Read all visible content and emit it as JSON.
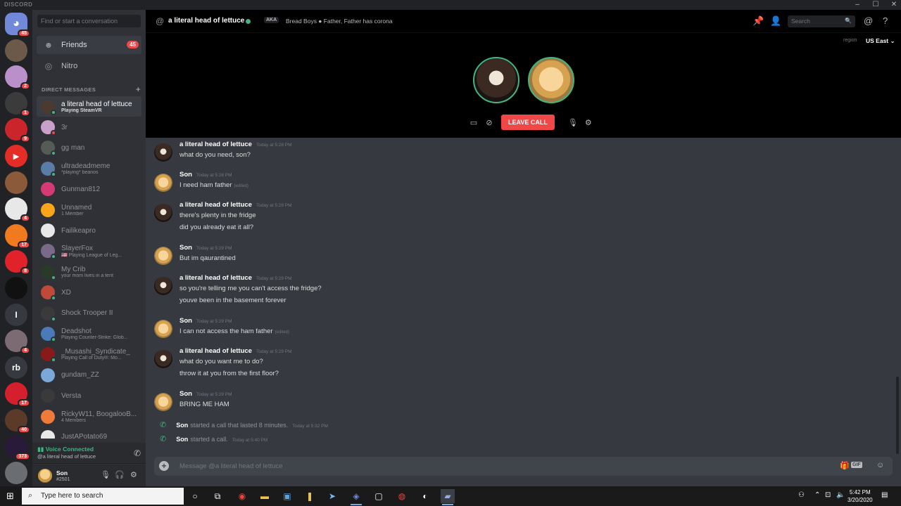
{
  "app": {
    "brand": "DISCORD"
  },
  "window_controls": [
    "–",
    "☐",
    "✕"
  ],
  "rail": {
    "items": [
      {
        "icon": "discord-home-icon",
        "badge": "45",
        "color": "#7289da",
        "label": ""
      },
      {
        "icon": "server-avatar-icon",
        "badge": "",
        "color": "#6b5a4a",
        "label": ""
      },
      {
        "icon": "server-avatar-icon",
        "badge": "2",
        "color": "#b990c9",
        "label": ""
      },
      {
        "icon": "server-avatar-icon",
        "badge": "1",
        "color": "#3b3b3b",
        "label": ""
      },
      {
        "icon": "server-avatar-icon",
        "badge": "9",
        "color": "#c9252b",
        "label": ""
      },
      {
        "icon": "youtube-server-icon",
        "badge": "",
        "color": "#e52d27",
        "label": ""
      },
      {
        "icon": "server-avatar-icon",
        "badge": "",
        "color": "#8a5a3a",
        "label": ""
      },
      {
        "icon": "server-avatar-icon",
        "badge": "4",
        "color": "#e8e8e8",
        "label": ""
      },
      {
        "icon": "server-avatar-icon",
        "badge": "17",
        "color": "#f07a1e",
        "label": ""
      },
      {
        "icon": "server-avatar-icon",
        "badge": "8",
        "color": "#e0222a",
        "label": ""
      },
      {
        "icon": "server-avatar-icon",
        "badge": "",
        "color": "#111111",
        "label": ""
      },
      {
        "icon": "server-letter-icon",
        "badge": "",
        "color": "#36393f",
        "label": "I"
      },
      {
        "icon": "server-avatar-icon",
        "badge": "4",
        "color": "#7d6b74",
        "label": ""
      },
      {
        "icon": "server-letter-icon",
        "badge": "",
        "color": "#36393f",
        "label": "rb"
      },
      {
        "icon": "server-avatar-icon",
        "badge": "17",
        "color": "#d41f2c",
        "label": ""
      },
      {
        "icon": "server-avatar-icon",
        "badge": "40",
        "color": "#5b3a2a",
        "label": ""
      },
      {
        "icon": "server-avatar-icon",
        "badge": "373",
        "color": "#2a1a3a",
        "label": ""
      },
      {
        "icon": "server-avatar-icon",
        "badge": "",
        "color": "#6a6d72",
        "label": ""
      }
    ]
  },
  "sidebar": {
    "search_placeholder": "Find or start a conversation",
    "friends_label": "Friends",
    "friends_count": "45",
    "nitro_label": "Nitro",
    "dm_header": "DIRECT MESSAGES",
    "dms": [
      {
        "name": "a literal head of lettuce",
        "sub": "Playing SteamVR",
        "status": "#43b581",
        "color": "#4a3a30",
        "active": true
      },
      {
        "name": "3r",
        "sub": "",
        "status": "#f04747",
        "color": "#c9a0c9"
      },
      {
        "name": "gg man",
        "sub": "",
        "status": "#43b581",
        "color": "#555b55"
      },
      {
        "name": "ultradeadmeme",
        "sub": "*playing* beanos",
        "status": "#43b581",
        "color": "#5a7da8"
      },
      {
        "name": "Gunman812",
        "sub": "",
        "status": "",
        "color": "#d43a76"
      },
      {
        "name": "Unnamed",
        "sub": "1 Member",
        "status": "",
        "color": "#faa61a"
      },
      {
        "name": "Failikeapro",
        "sub": "",
        "status": "",
        "color": "#e8e8e8"
      },
      {
        "name": "SlayerFox",
        "sub": "🇺🇸 Playing League of Leg...",
        "status": "#43b581",
        "color": "#7a6a8a"
      },
      {
        "name": "My Crib",
        "sub": "your mom lives in a tent",
        "status": "#43b581",
        "color": "#2a3a2a"
      },
      {
        "name": "XD",
        "sub": "",
        "status": "#43b581",
        "color": "#c04a3a"
      },
      {
        "name": "Shock Trooper II",
        "sub": "",
        "status": "#43b581",
        "color": "#3a3a3a"
      },
      {
        "name": "Deadshot",
        "sub": "Playing Counter-Strike: Glob...",
        "status": "#43b581",
        "color": "#4a7ab8"
      },
      {
        "name": "_Musashi_Syndicate_",
        "sub": "Playing Call of Duty®: Mo...",
        "status": "#43b581",
        "color": "#8a1a1a"
      },
      {
        "name": "gundam_ZZ",
        "sub": "",
        "status": "",
        "color": "#7aa8d8"
      },
      {
        "name": "Versta",
        "sub": "",
        "status": "",
        "color": "#3a3a3a"
      },
      {
        "name": "RickyW11, BoogalooB...",
        "sub": "4 Members",
        "status": "",
        "color": "#f07a3a"
      },
      {
        "name": "JustAPotato69",
        "sub": "",
        "status": "",
        "color": "#e8e8e8"
      }
    ],
    "voice_status": "Voice Connected",
    "voice_target": "@a literal head of lettuce",
    "username": "Son",
    "discriminator": "#2501"
  },
  "topbar": {
    "channel_name": "a literal head of lettuce",
    "aka_label": "AKA",
    "aka_text": "Bread Boys ● Father, Father has corona",
    "search_placeholder": "Search"
  },
  "call": {
    "region_label": "region",
    "region_value": "US East ⌄",
    "leave_label": "LEAVE CALL"
  },
  "messages": [
    {
      "author": "a literal head of lettuce",
      "avatar": "lettuce",
      "time": "Today at 5:28 PM",
      "lines": [
        "what do you need, son?"
      ],
      "edited": false
    },
    {
      "author": "Son",
      "avatar": "son",
      "time": "Today at 5:28 PM",
      "lines": [
        "I need ham father"
      ],
      "edited": true
    },
    {
      "author": "a literal head of lettuce",
      "avatar": "lettuce",
      "time": "Today at 5:28 PM",
      "lines": [
        "there's plenty in the fridge",
        "did you already eat it all?"
      ],
      "edited": false
    },
    {
      "author": "Son",
      "avatar": "son",
      "time": "Today at 5:29 PM",
      "lines": [
        "But im qaurantined"
      ],
      "edited": false
    },
    {
      "author": "a literal head of lettuce",
      "avatar": "lettuce",
      "time": "Today at 5:29 PM",
      "lines": [
        "so you're telling me you can't access the fridge?",
        "youve been in the basement forever"
      ],
      "edited": false
    },
    {
      "author": "Son",
      "avatar": "son",
      "time": "Today at 5:29 PM",
      "lines": [
        "I can not access the ham father"
      ],
      "edited": true
    },
    {
      "author": "a literal head of lettuce",
      "avatar": "lettuce",
      "time": "Today at 5:29 PM",
      "lines": [
        "what do you want me to do?",
        "throw it at you from the first floor?"
      ],
      "edited": false
    },
    {
      "author": "Son",
      "avatar": "son",
      "time": "Today at 5:29 PM",
      "lines": [
        "BRING ME HAM"
      ],
      "edited": false
    }
  ],
  "edited_label": "(edited)",
  "system_messages": [
    {
      "author": "Son",
      "text": "started a call that lasted 8 minutes.",
      "time": "Today at 5:32 PM"
    },
    {
      "author": "Son",
      "text": "started a call.",
      "time": "Today at 5:40 PM"
    }
  ],
  "composer": {
    "placeholder": "Message @a literal head of lettuce",
    "gif_label": "GIF"
  },
  "taskbar": {
    "search_placeholder": "Type here to search",
    "time": "5:42 PM",
    "date": "3/20/2020"
  }
}
